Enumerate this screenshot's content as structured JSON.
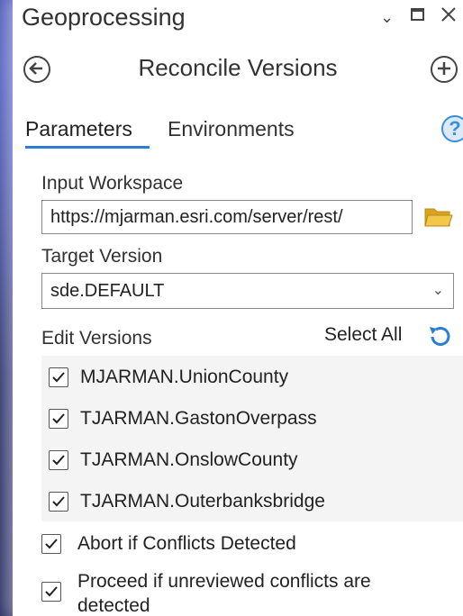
{
  "window": {
    "title": "Geoprocessing",
    "controls": [
      "chevron-down-icon",
      "maximize-icon",
      "close-icon"
    ]
  },
  "header": {
    "title": "Reconcile Versions",
    "back_icon": "back-arrow-icon",
    "add_icon": "plus-icon"
  },
  "tabs": [
    {
      "label": "Parameters",
      "active": true
    },
    {
      "label": "Environments",
      "active": false
    }
  ],
  "help_label": "?",
  "input_workspace": {
    "label": "Input Workspace",
    "value": "https://mjarman.esri.com/server/rest/"
  },
  "target_version": {
    "label": "Target Version",
    "value": "sde.DEFAULT"
  },
  "edit_versions": {
    "label": "Edit Versions",
    "select_all": "Select All",
    "items": [
      {
        "label": "MJARMAN.UnionCounty",
        "checked": true
      },
      {
        "label": "TJARMAN.GastonOverpass",
        "checked": true
      },
      {
        "label": "TJARMAN.OnslowCounty",
        "checked": true
      },
      {
        "label": "TJARMAN.Outerbanksbridge",
        "checked": true
      }
    ]
  },
  "options": [
    {
      "label": "Abort if Conflicts Detected",
      "checked": true
    },
    {
      "label": "Proceed if unreviewed conflicts are detected",
      "checked": true
    }
  ],
  "colors": {
    "accent": "#2a7fd4",
    "folder": "#e6b530",
    "text": "#323232"
  }
}
